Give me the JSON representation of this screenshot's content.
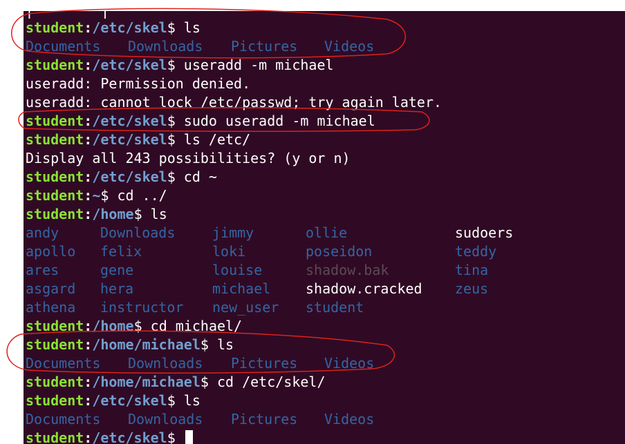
{
  "prompt": {
    "user": "student",
    "colon": ":",
    "dollar": "$"
  },
  "partial_top": "[        ]",
  "session": [
    {
      "kind": "cmd",
      "path": "/etc/skel",
      "command": " ls"
    },
    {
      "kind": "dirs",
      "items": [
        "Documents",
        "Downloads",
        "Pictures",
        "Videos"
      ]
    },
    {
      "kind": "cmd",
      "path": "/etc/skel",
      "command": " useradd -m michael"
    },
    {
      "kind": "out",
      "text": "useradd: Permission denied."
    },
    {
      "kind": "out",
      "text": "useradd: cannot lock /etc/passwd; try again later."
    },
    {
      "kind": "cmd",
      "path": "/etc/skel",
      "command": " sudo useradd -m michael"
    },
    {
      "kind": "cmd",
      "path": "/etc/skel",
      "command": " ls /etc/"
    },
    {
      "kind": "out",
      "text": "Display all 243 possibilities? (y or n)"
    },
    {
      "kind": "cmd",
      "path": "/etc/skel",
      "command": " cd ~"
    },
    {
      "kind": "cmd",
      "path": "~",
      "command": " cd ../"
    },
    {
      "kind": "cmd",
      "path": "/home",
      "command": " ls"
    }
  ],
  "home_listing": [
    [
      "andy",
      "Downloads",
      "jimmy",
      "ollie",
      "sudoers"
    ],
    [
      "apollo",
      "felix",
      "loki",
      "poseidon",
      "teddy"
    ],
    [
      "ares",
      "gene",
      "louise",
      "shadow.bak",
      "tina"
    ],
    [
      "asgard",
      "hera",
      "michael",
      "shadow.cracked",
      "zeus"
    ],
    [
      "athena",
      "instructor",
      "new_user",
      "student",
      ""
    ]
  ],
  "home_listing_types": [
    [
      "dir",
      "dir",
      "dir",
      "dir",
      "file"
    ],
    [
      "dir",
      "dir",
      "dir",
      "dir",
      "dir"
    ],
    [
      "dir",
      "dir",
      "dir",
      "dim",
      "dir"
    ],
    [
      "dir",
      "dir",
      "dir",
      "file",
      "dir"
    ],
    [
      "dir",
      "dir",
      "dir",
      "dir",
      ""
    ]
  ],
  "session2": [
    {
      "kind": "cmd",
      "path": "/home",
      "command": " cd michael/"
    },
    {
      "kind": "cmd",
      "path": "/home/michael",
      "command": " ls"
    },
    {
      "kind": "dirs",
      "items": [
        "Documents",
        "Downloads",
        "Pictures",
        "Videos"
      ]
    },
    {
      "kind": "cmd",
      "path": "/home/michael",
      "command": " cd /etc/skel/"
    },
    {
      "kind": "cmd",
      "path": "/etc/skel",
      "command": " ls"
    },
    {
      "kind": "dirs",
      "items": [
        "Documents",
        "Downloads",
        "Pictures",
        "Videos"
      ]
    },
    {
      "kind": "cmd",
      "path": "/etc/skel",
      "command": " ",
      "cursor": true
    }
  ],
  "colors": {
    "background": "#300a24",
    "user": "#8ae234",
    "path": "#729fcf",
    "dir": "#3465a4",
    "annotation": "#e0201c"
  }
}
